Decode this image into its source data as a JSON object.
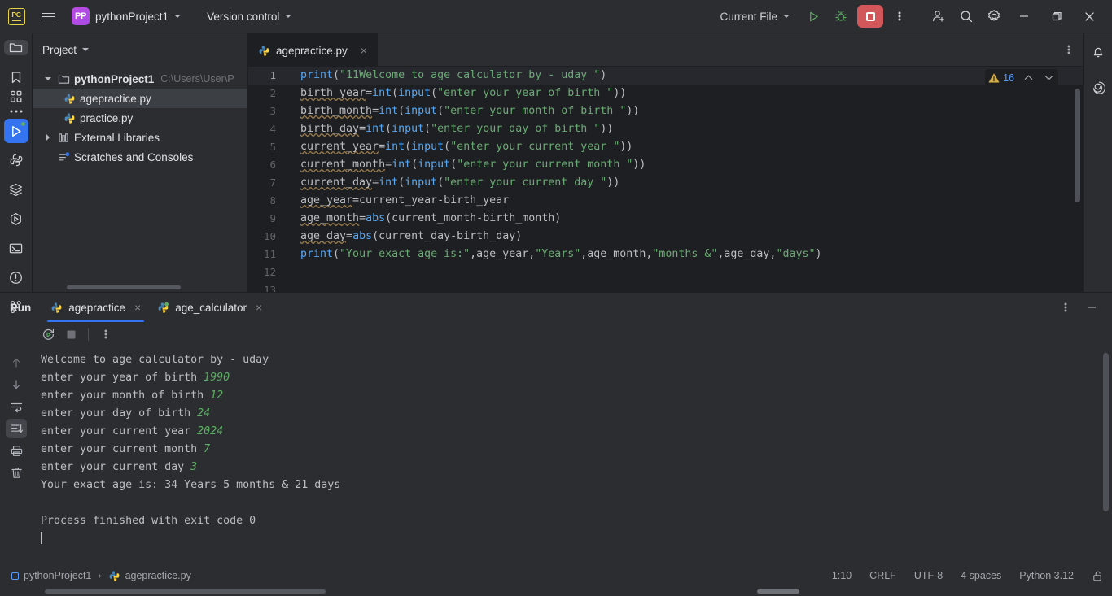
{
  "titlebar": {
    "logo": "pc-logo",
    "project_badge": "PP",
    "project_name": "pythonProject1",
    "version_control": "Version control",
    "run_config": "Current File",
    "icons": {
      "run": "run-icon",
      "debug": "debug-icon",
      "stop": "stop-icon",
      "more": "more-options-icon",
      "share": "add-user-icon",
      "search": "search-icon",
      "settings": "gear-icon",
      "minimize": "minimize-icon",
      "maximize": "maximize-icon",
      "close": "close-icon"
    }
  },
  "sidebar": {
    "title": "Project",
    "tree": [
      {
        "label": "pythonProject1",
        "path": "C:\\Users\\User\\P",
        "kind": "folder",
        "expanded": true,
        "selected": false,
        "indent": 0
      },
      {
        "label": "agepractice.py",
        "path": "",
        "kind": "python",
        "expanded": false,
        "selected": true,
        "indent": 1
      },
      {
        "label": "practice.py",
        "path": "",
        "kind": "python",
        "expanded": false,
        "selected": false,
        "indent": 1
      },
      {
        "label": "External Libraries",
        "path": "",
        "kind": "library",
        "expanded": false,
        "selected": false,
        "indent": 0
      },
      {
        "label": "Scratches and Consoles",
        "path": "",
        "kind": "scratch",
        "expanded": false,
        "selected": false,
        "indent": 0
      }
    ]
  },
  "rail": {
    "top": [
      "project-icon",
      "bookmarks-icon",
      "structure-icon",
      "more-tool-windows-icon"
    ],
    "bottom": [
      "run-tool-icon",
      "python-console-icon",
      "packages-icon",
      "services-icon",
      "terminal-icon",
      "problems-icon",
      "git-icon"
    ]
  },
  "right_rail": [
    "notifications-icon",
    "ai-assistant-icon"
  ],
  "editor": {
    "tab": {
      "label": "agepractice.py",
      "icon": "python-file-icon",
      "close": "×"
    },
    "kebab": "more-options-icon",
    "warnings": {
      "count": "16",
      "icon": "warning-triangle-icon",
      "up": "prev-problem-icon",
      "down": "next-problem-icon"
    },
    "current_line": 1,
    "lines": [
      {
        "n": "1",
        "tokens": [
          {
            "t": "print",
            "c": "fn"
          },
          {
            "t": "(",
            "c": "op"
          },
          {
            "t": "\"11Welcome to age calculator by - uday \"",
            "c": "str"
          },
          {
            "t": ")",
            "c": "op"
          }
        ]
      },
      {
        "n": "2",
        "tokens": [
          {
            "t": "birth_year",
            "c": "op",
            "squiggle": true
          },
          {
            "t": "=",
            "c": "op"
          },
          {
            "t": "int",
            "c": "fn"
          },
          {
            "t": "(",
            "c": "op"
          },
          {
            "t": "input",
            "c": "fn"
          },
          {
            "t": "(",
            "c": "op"
          },
          {
            "t": "\"enter your year of birth \"",
            "c": "str"
          },
          {
            "t": "))",
            "c": "op"
          }
        ]
      },
      {
        "n": "3",
        "tokens": [
          {
            "t": "birth_month",
            "c": "op",
            "squiggle": true
          },
          {
            "t": "=",
            "c": "op"
          },
          {
            "t": "int",
            "c": "fn"
          },
          {
            "t": "(",
            "c": "op"
          },
          {
            "t": "input",
            "c": "fn"
          },
          {
            "t": "(",
            "c": "op"
          },
          {
            "t": "\"enter your month of birth \"",
            "c": "str"
          },
          {
            "t": "))",
            "c": "op"
          }
        ]
      },
      {
        "n": "4",
        "tokens": [
          {
            "t": "birth_day",
            "c": "op",
            "squiggle": true
          },
          {
            "t": "=",
            "c": "op"
          },
          {
            "t": "int",
            "c": "fn"
          },
          {
            "t": "(",
            "c": "op"
          },
          {
            "t": "input",
            "c": "fn"
          },
          {
            "t": "(",
            "c": "op"
          },
          {
            "t": "\"enter your day of birth \"",
            "c": "str"
          },
          {
            "t": "))",
            "c": "op"
          }
        ]
      },
      {
        "n": "5",
        "tokens": [
          {
            "t": "current_year",
            "c": "op",
            "squiggle": true
          },
          {
            "t": "=",
            "c": "op"
          },
          {
            "t": "int",
            "c": "fn"
          },
          {
            "t": "(",
            "c": "op"
          },
          {
            "t": "input",
            "c": "fn"
          },
          {
            "t": "(",
            "c": "op"
          },
          {
            "t": "\"enter your current year \"",
            "c": "str"
          },
          {
            "t": "))",
            "c": "op"
          }
        ]
      },
      {
        "n": "6",
        "tokens": [
          {
            "t": "current_month",
            "c": "op",
            "squiggle": true
          },
          {
            "t": "=",
            "c": "op"
          },
          {
            "t": "int",
            "c": "fn"
          },
          {
            "t": "(",
            "c": "op"
          },
          {
            "t": "input",
            "c": "fn"
          },
          {
            "t": "(",
            "c": "op"
          },
          {
            "t": "\"enter your current month \"",
            "c": "str"
          },
          {
            "t": "))",
            "c": "op"
          }
        ]
      },
      {
        "n": "7",
        "tokens": [
          {
            "t": "current_day",
            "c": "op",
            "squiggle": true
          },
          {
            "t": "=",
            "c": "op"
          },
          {
            "t": "int",
            "c": "fn"
          },
          {
            "t": "(",
            "c": "op"
          },
          {
            "t": "input",
            "c": "fn"
          },
          {
            "t": "(",
            "c": "op"
          },
          {
            "t": "\"enter your current day \"",
            "c": "str"
          },
          {
            "t": "))",
            "c": "op"
          }
        ]
      },
      {
        "n": "8",
        "tokens": [
          {
            "t": "age_year",
            "c": "op",
            "squiggle": true
          },
          {
            "t": "=current_year-birth_year",
            "c": "op"
          }
        ]
      },
      {
        "n": "9",
        "tokens": [
          {
            "t": "age_month",
            "c": "op",
            "squiggle": true
          },
          {
            "t": "=",
            "c": "op"
          },
          {
            "t": "abs",
            "c": "fn"
          },
          {
            "t": "(current_month-birth_month)",
            "c": "op"
          }
        ]
      },
      {
        "n": "10",
        "tokens": [
          {
            "t": "age_day",
            "c": "op",
            "squiggle": true
          },
          {
            "t": "=",
            "c": "op"
          },
          {
            "t": "abs",
            "c": "fn"
          },
          {
            "t": "(current_day-birth_day)",
            "c": "op"
          }
        ]
      },
      {
        "n": "11",
        "tokens": [
          {
            "t": "print",
            "c": "fn"
          },
          {
            "t": "(",
            "c": "op"
          },
          {
            "t": "\"Your exact age is:\"",
            "c": "str"
          },
          {
            "t": ",age_year,",
            "c": "op"
          },
          {
            "t": "\"Years\"",
            "c": "str"
          },
          {
            "t": ",age_month,",
            "c": "op"
          },
          {
            "t": "\"months &\"",
            "c": "str"
          },
          {
            "t": ",age_day,",
            "c": "op"
          },
          {
            "t": "\"days\"",
            "c": "str"
          },
          {
            "t": ")",
            "c": "op"
          }
        ]
      },
      {
        "n": "12",
        "tokens": []
      },
      {
        "n": "13",
        "tokens": []
      }
    ]
  },
  "run_panel": {
    "title": "Run",
    "tabs": [
      {
        "label": "agepractice",
        "icon": "python-run-icon",
        "active": true,
        "close": "×"
      },
      {
        "label": "age_calculator",
        "icon": "python-run-icon",
        "active": false,
        "close": "×"
      }
    ],
    "toolbar": [
      "rerun-icon",
      "stop-icon",
      "more-options-icon"
    ],
    "panel_actions": [
      "panel-options-icon",
      "minimize-panel-icon"
    ],
    "gutter": [
      "scroll-up-icon",
      "scroll-down-icon",
      "soft-wrap-icon",
      "scroll-to-end-icon",
      "print-icon",
      "clear-all-icon"
    ],
    "console": [
      {
        "text": "Welcome to age calculator by - uday",
        "input": ""
      },
      {
        "text": "enter your year of birth ",
        "input": "1990"
      },
      {
        "text": "enter your month of birth ",
        "input": "12"
      },
      {
        "text": "enter your day of birth ",
        "input": "24"
      },
      {
        "text": "enter your current year ",
        "input": "2024"
      },
      {
        "text": "enter your current month ",
        "input": "7"
      },
      {
        "text": "enter your current day ",
        "input": "3"
      },
      {
        "text": "Your exact age is: 34 Years 5 months & 21 days",
        "input": ""
      },
      {
        "text": "",
        "input": ""
      },
      {
        "text": "Process finished with exit code 0",
        "input": ""
      }
    ]
  },
  "status_bar": {
    "project": "pythonProject1",
    "separator": "›",
    "file": "agepractice.py",
    "caret": "1:10",
    "line_sep": "CRLF",
    "encoding": "UTF-8",
    "indent": "4 spaces",
    "interpreter": "Python 3.12",
    "lock": "unlocked-icon"
  }
}
